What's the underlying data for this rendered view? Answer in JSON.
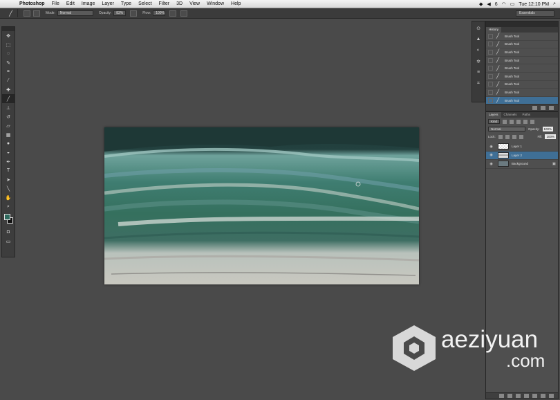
{
  "menubar": {
    "app": "Photoshop",
    "menus": [
      "File",
      "Edit",
      "Image",
      "Layer",
      "Type",
      "Select",
      "Filter",
      "3D",
      "View",
      "Window",
      "Help"
    ],
    "status_items": [
      "6",
      "Tue 12:10 PM"
    ]
  },
  "options": {
    "mode_label": "Mode:",
    "mode_value": "Normal",
    "opacity_label": "Opacity:",
    "opacity_value": "83%",
    "flow_label": "Flow:",
    "flow_value": "100%",
    "workspace": "Essentials"
  },
  "tools": [
    "move-tool",
    "marquee-tool",
    "lasso-tool",
    "quick-select-tool",
    "crop-tool",
    "eyedropper-tool",
    "healing-tool",
    "brush-tool",
    "clone-stamp-tool",
    "history-brush-tool",
    "eraser-tool",
    "gradient-tool",
    "blur-tool",
    "dodge-tool",
    "pen-tool",
    "type-tool",
    "path-select-tool",
    "shape-tool",
    "hand-tool",
    "zoom-tool"
  ],
  "colors": {
    "foreground": "#2f6b5f",
    "background": "#111111",
    "accent_selection": "#3f6f96"
  },
  "history": {
    "title": "History",
    "items": [
      {
        "label": "Brush Tool"
      },
      {
        "label": "Brush Tool"
      },
      {
        "label": "Brush Tool"
      },
      {
        "label": "Brush Tool"
      },
      {
        "label": "Brush Tool"
      },
      {
        "label": "Brush Tool"
      },
      {
        "label": "Brush Tool"
      },
      {
        "label": "Brush Tool"
      },
      {
        "label": "Brush Tool"
      }
    ],
    "selected_index": 8
  },
  "layers_panel": {
    "tabs": [
      "Layers",
      "Channels",
      "Paths"
    ],
    "filter_label": "Kind",
    "blend_mode": "Normal",
    "opacity_label": "Opacity:",
    "opacity_value": "100%",
    "lock_label": "Lock:",
    "fill_label": "Fill:",
    "fill_value": "100%",
    "layers": [
      {
        "name": "Layer 1",
        "selected": false
      },
      {
        "name": "Layer 2",
        "selected": true
      },
      {
        "name": "Background",
        "selected": false,
        "locked": true
      }
    ]
  },
  "watermark": {
    "brand": "aeziyuan",
    "tld": ".com"
  }
}
